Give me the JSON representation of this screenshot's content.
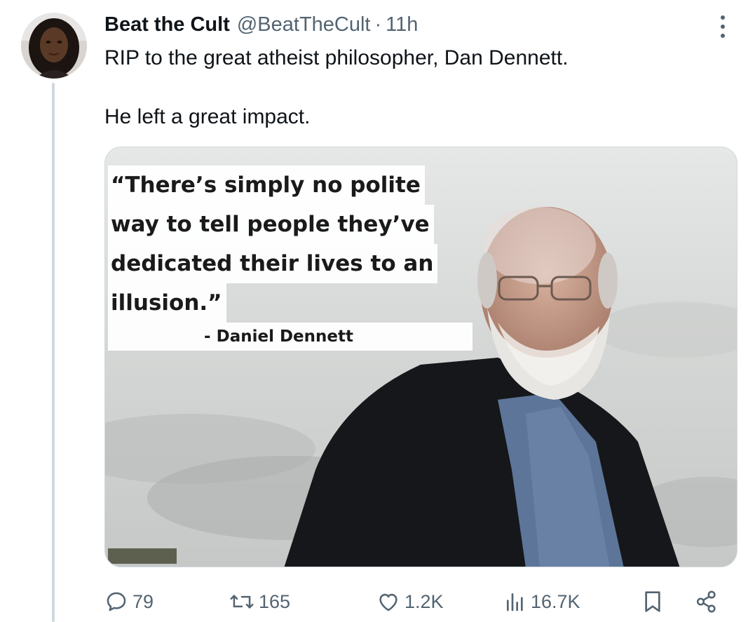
{
  "author": {
    "display_name": "Beat the Cult",
    "handle": "@BeatTheCult",
    "separator": "·",
    "time": "11h",
    "avatar_icon": "profile-photo"
  },
  "tweet": {
    "line1": "RIP to the great atheist philosopher, Dan Dennett.",
    "line2": "He left a great impact."
  },
  "media": {
    "quote_lines": [
      "“There’s simply no polite",
      "way to tell people they’ve",
      "dedicated their lives to an",
      "illusion.”"
    ],
    "attribution": "- Daniel Dennett"
  },
  "actions": {
    "replies": "79",
    "reposts": "165",
    "likes": "1.2K",
    "views": "16.7K",
    "icons": [
      "reply-icon",
      "repost-icon",
      "like-icon",
      "views-icon",
      "bookmark-icon",
      "share-icon"
    ]
  },
  "colors": {
    "text": "#0f1419",
    "secondary": "#536471",
    "border": "#cfd9de",
    "background": "#ffffff"
  }
}
